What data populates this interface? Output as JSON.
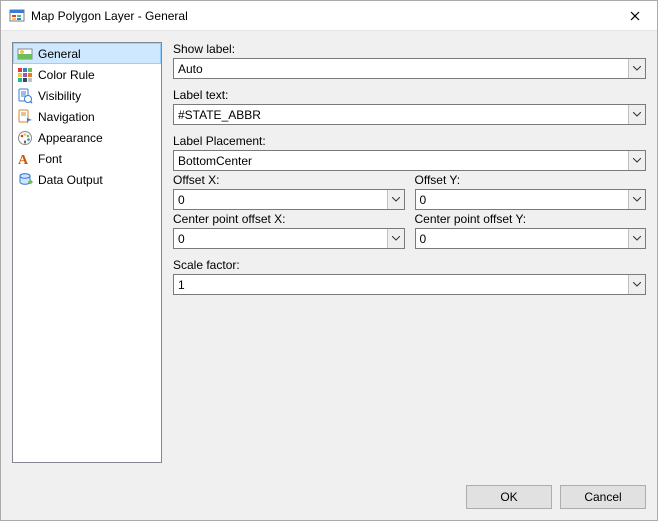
{
  "window": {
    "title": "Map Polygon Layer - General"
  },
  "sidebar": {
    "items": [
      {
        "label": "General",
        "icon": "general-icon",
        "selected": true
      },
      {
        "label": "Color Rule",
        "icon": "color-rule-icon",
        "selected": false
      },
      {
        "label": "Visibility",
        "icon": "visibility-icon",
        "selected": false
      },
      {
        "label": "Navigation",
        "icon": "navigation-icon",
        "selected": false
      },
      {
        "label": "Appearance",
        "icon": "appearance-icon",
        "selected": false
      },
      {
        "label": "Font",
        "icon": "font-icon",
        "selected": false
      },
      {
        "label": "Data Output",
        "icon": "data-output-icon",
        "selected": false
      }
    ]
  },
  "form": {
    "show_label": {
      "label": "Show label:",
      "value": "Auto"
    },
    "label_text": {
      "label": "Label text:",
      "value": "#STATE_ABBR"
    },
    "label_place": {
      "label": "Label Placement:",
      "value": "BottomCenter"
    },
    "offset_x": {
      "label": "Offset X:",
      "value": "0"
    },
    "offset_y": {
      "label": "Offset Y:",
      "value": "0"
    },
    "cp_offset_x": {
      "label": "Center point offset X:",
      "value": "0"
    },
    "cp_offset_y": {
      "label": "Center point offset Y:",
      "value": "0"
    },
    "scale_factor": {
      "label": "Scale factor:",
      "value": "1"
    }
  },
  "buttons": {
    "ok": "OK",
    "cancel": "Cancel"
  }
}
